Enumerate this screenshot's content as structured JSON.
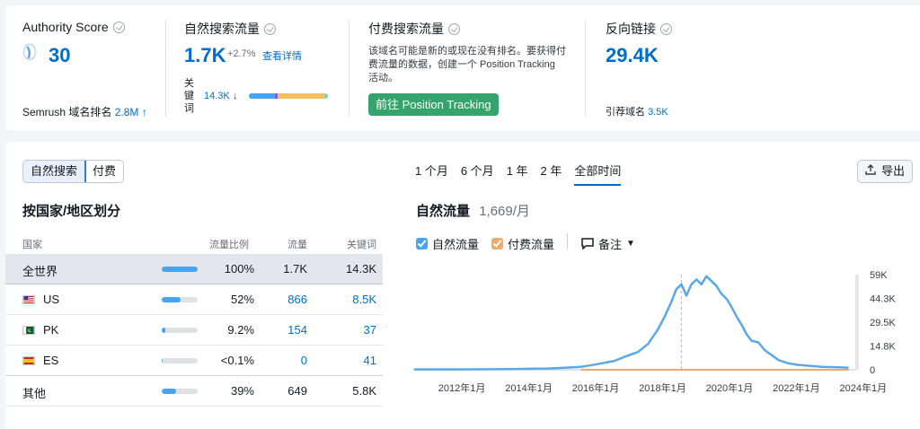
{
  "authority": {
    "title": "Authority Score",
    "score": "30",
    "rank_label": "Semrush 域名排名",
    "rank_value": "2.8M",
    "rank_arrow": "↑"
  },
  "organic": {
    "title": "自然搜索流量",
    "value": "1.7K",
    "change": "+2.7%",
    "details_link": "查看详情",
    "kw_label": "关键词",
    "kw_value": "14.3K",
    "kw_arrow": "↓"
  },
  "paid": {
    "title": "付费搜索流量",
    "description": "该域名可能是新的或现在没有排名。要获得付费流量的数据，创建一个 Position Tracking 活动。",
    "button": "前往 Position Tracking"
  },
  "backlinks": {
    "title": "反向链接",
    "value": "29.4K",
    "ref_label": "引荐域名",
    "ref_value": "3.5K"
  },
  "tabs": {
    "organic": "自然搜索",
    "paid": "付费"
  },
  "country_section": {
    "title": "按国家/地区划分",
    "headers": {
      "country": "国家",
      "share": "流量比例",
      "traffic": "流量",
      "keywords": "关键词"
    },
    "rows": [
      {
        "country": "全世界",
        "share": "100%",
        "share_value": 1.0,
        "traffic": "1.7K",
        "keywords": "14.3K"
      },
      {
        "country": "US",
        "flag": "us-flag-icon",
        "share": "52%",
        "share_value": 0.52,
        "traffic": "866",
        "keywords": "8.5K"
      },
      {
        "country": "PK",
        "flag": "pk-flag-icon",
        "share": "9.2%",
        "share_value": 0.092,
        "traffic": "154",
        "keywords": "37"
      },
      {
        "country": "ES",
        "flag": "es-flag-icon",
        "share": "<0.1%",
        "share_value": 0.001,
        "traffic": "0",
        "keywords": "41"
      },
      {
        "country": "其他",
        "share": "39%",
        "share_value": 0.39,
        "traffic": "649",
        "keywords": "5.8K"
      }
    ]
  },
  "time_ranges": [
    "1 个月",
    "6 个月",
    "1 年",
    "2 年",
    "全部时间"
  ],
  "selected_range": "全部时间",
  "export_label": "导出",
  "traffic_section": {
    "title": "自然流量",
    "subtitle": "1,669/月"
  },
  "legend": {
    "organic": "自然流量",
    "paid": "付费流量",
    "notes": "备注"
  },
  "colors": {
    "organic": "#5aa8e6",
    "paid": "#f0a86b",
    "button_green": "#34a46c",
    "accent": "#006dca"
  },
  "chart_data": {
    "type": "line",
    "x_ticks": [
      "2012年1月",
      "2014年1月",
      "2016年1月",
      "2018年1月",
      "2020年1月",
      "2022年1月",
      "2024年1月"
    ],
    "y_ticks": [
      "59K",
      "44.3K",
      "29.5K",
      "14.8K",
      "0"
    ],
    "ylim": [
      0,
      59000
    ],
    "series": [
      {
        "name": "自然流量",
        "color": "#5aa8e6",
        "points": [
          [
            2011.0,
            200
          ],
          [
            2012.0,
            200
          ],
          [
            2013.0,
            300
          ],
          [
            2014.0,
            400
          ],
          [
            2014.5,
            600
          ],
          [
            2015.0,
            800
          ],
          [
            2015.5,
            1200
          ],
          [
            2016.0,
            1800
          ],
          [
            2016.5,
            3500
          ],
          [
            2017.0,
            5500
          ],
          [
            2017.3,
            8000
          ],
          [
            2017.7,
            11000
          ],
          [
            2018.0,
            16000
          ],
          [
            2018.3,
            25000
          ],
          [
            2018.5,
            33000
          ],
          [
            2018.7,
            42000
          ],
          [
            2018.85,
            50000
          ],
          [
            2019.0,
            53000
          ],
          [
            2019.15,
            46000
          ],
          [
            2019.3,
            53000
          ],
          [
            2019.45,
            56000
          ],
          [
            2019.6,
            53000
          ],
          [
            2019.75,
            58000
          ],
          [
            2019.9,
            55000
          ],
          [
            2020.05,
            52000
          ],
          [
            2020.2,
            47000
          ],
          [
            2020.35,
            44000
          ],
          [
            2020.5,
            39000
          ],
          [
            2020.65,
            33000
          ],
          [
            2020.8,
            28000
          ],
          [
            2020.95,
            22000
          ],
          [
            2021.1,
            18000
          ],
          [
            2021.3,
            17000
          ],
          [
            2021.5,
            12000
          ],
          [
            2021.7,
            9000
          ],
          [
            2021.9,
            6000
          ],
          [
            2022.2,
            4000
          ],
          [
            2022.5,
            3000
          ],
          [
            2022.8,
            2500
          ],
          [
            2023.2,
            1800
          ],
          [
            2023.7,
            1500
          ],
          [
            2024.0,
            1300
          ]
        ]
      },
      {
        "name": "付费流量",
        "color": "#f0a86b",
        "points": [
          [
            2016.0,
            0
          ],
          [
            2024.0,
            0
          ]
        ]
      }
    ]
  }
}
